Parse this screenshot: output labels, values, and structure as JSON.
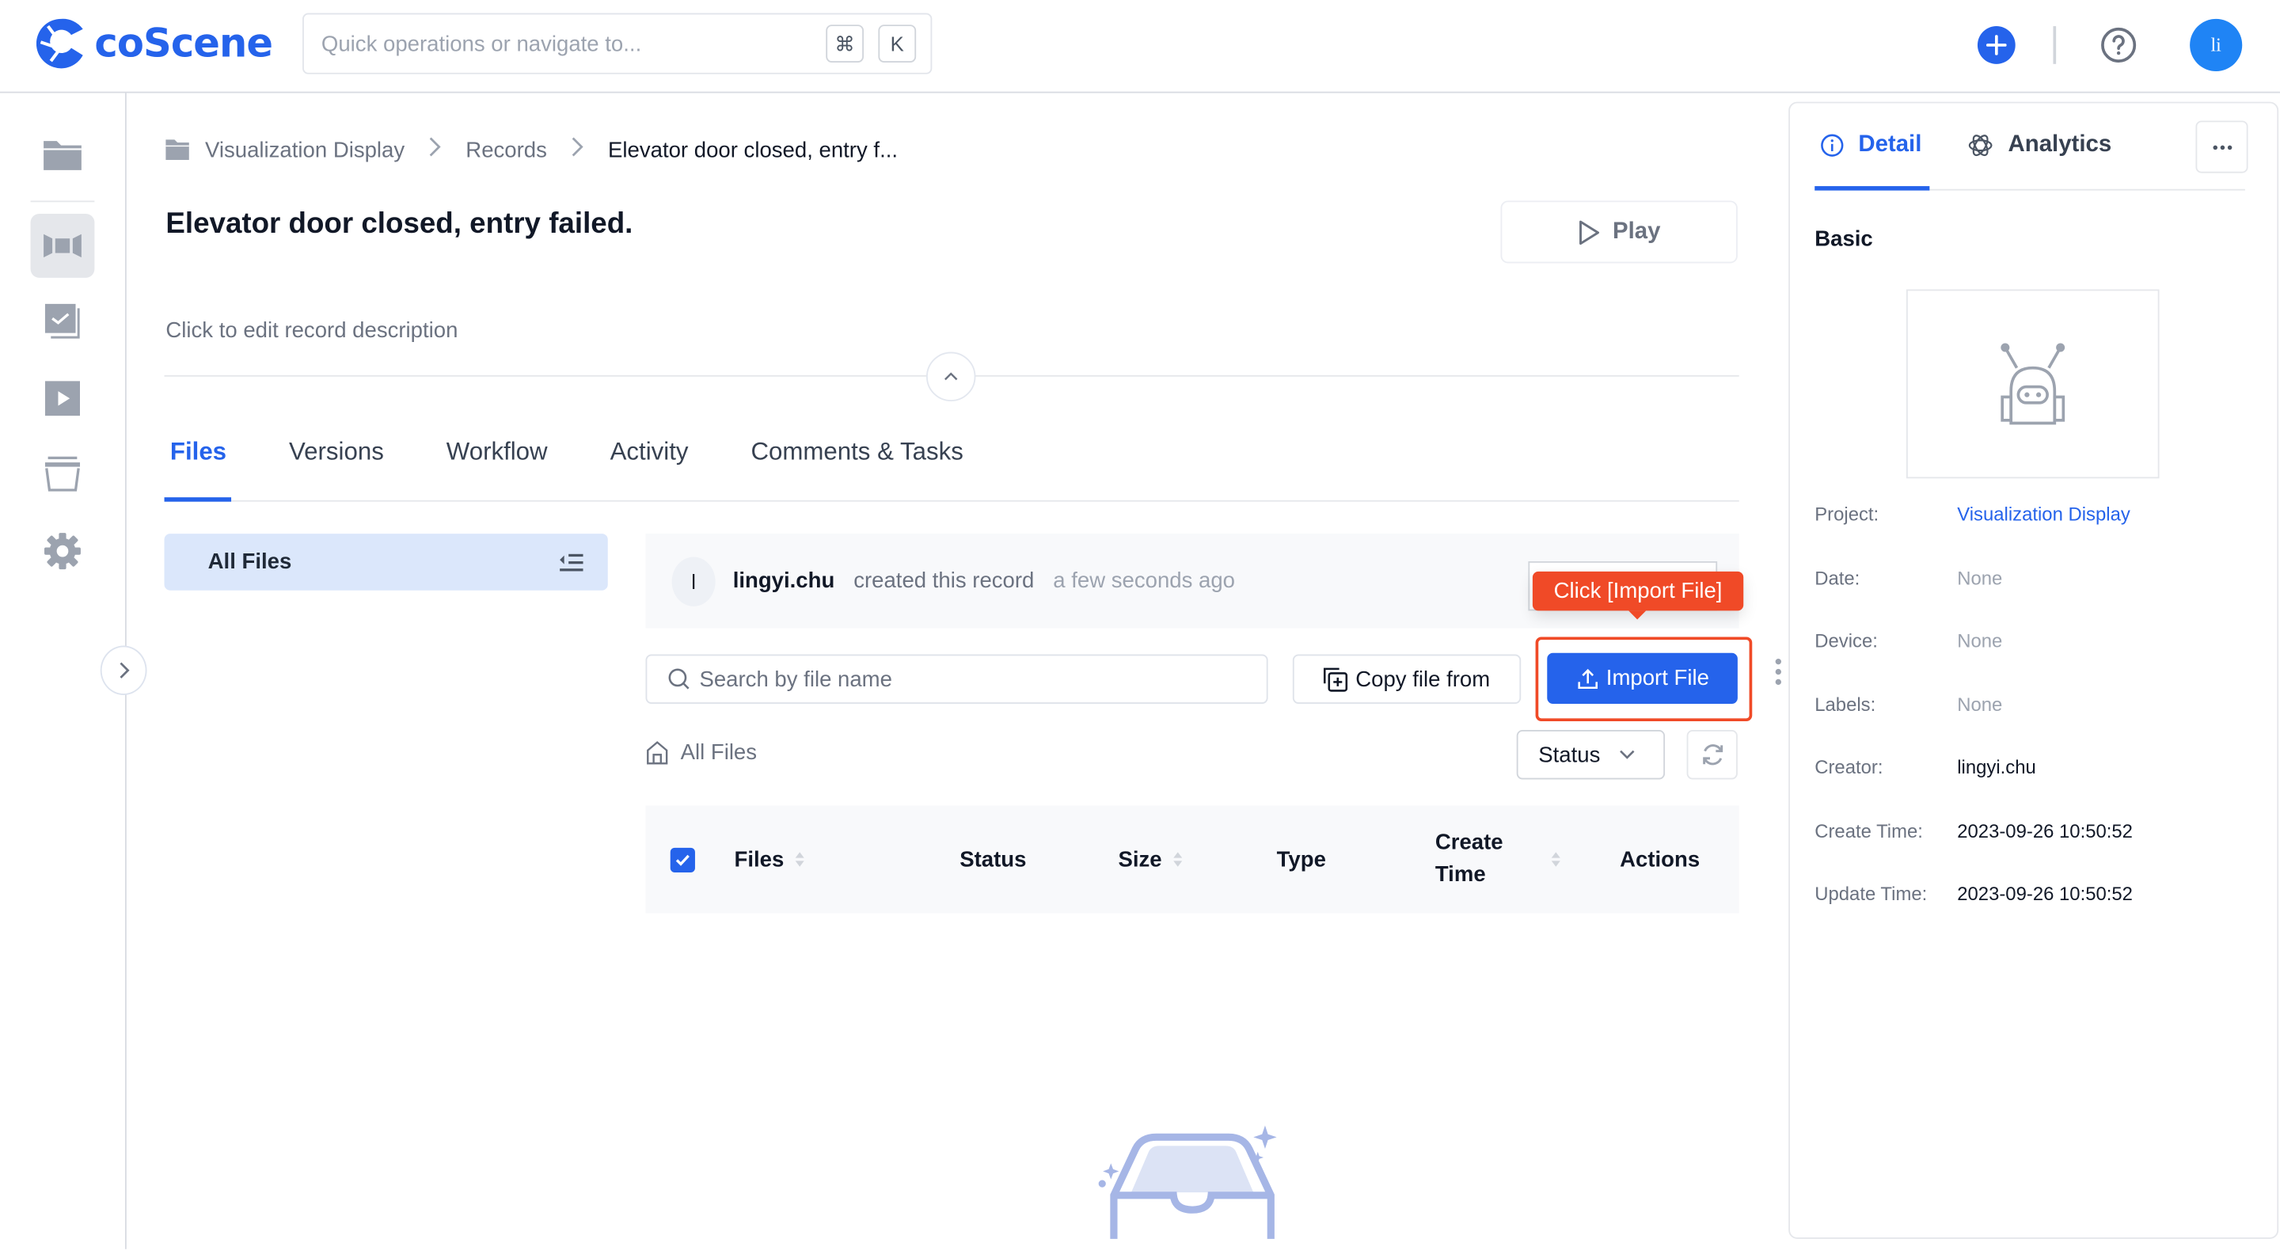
{
  "app": {
    "name": "coScene",
    "brand_color": "#2563eb",
    "search": {
      "placeholder": "Quick operations or navigate to...",
      "shortcut_keys": [
        "⌘",
        "K"
      ]
    },
    "avatar_initials": "li"
  },
  "sidebar": {
    "items": [
      {
        "name": "projects",
        "icon": "folder-icon",
        "active": false
      },
      {
        "name": "records",
        "icon": "records-icon",
        "active": true
      },
      {
        "name": "tasks",
        "icon": "task-check-icon",
        "active": false
      },
      {
        "name": "playback",
        "icon": "play-icon",
        "active": false
      },
      {
        "name": "archive",
        "icon": "archive-icon",
        "active": false
      },
      {
        "name": "settings",
        "icon": "gear-icon",
        "active": false
      }
    ]
  },
  "breadcrumb": {
    "items": [
      "Visualization Display",
      "Records",
      "Elevator door closed, entry f..."
    ]
  },
  "record": {
    "title": "Elevator door closed, entry failed.",
    "description_placeholder": "Click to edit record description",
    "play_label": "Play"
  },
  "tabs": [
    {
      "label": "Files",
      "active": true
    },
    {
      "label": "Versions",
      "active": false
    },
    {
      "label": "Workflow",
      "active": false
    },
    {
      "label": "Activity",
      "active": false
    },
    {
      "label": "Comments & Tasks",
      "active": false
    }
  ],
  "files": {
    "nav_label": "All Files",
    "activity": {
      "avatar": "l",
      "user": "lingyi.chu",
      "action": "created this record",
      "time": "a few seconds ago"
    },
    "search_placeholder": "Search by file name",
    "copy_label": "Copy file from",
    "import_label": "Import File",
    "tooltip": "Click [Import File]",
    "path_label": "All Files",
    "status_filter": "Status",
    "columns": [
      "Files",
      "Status",
      "Size",
      "Type",
      "Create Time",
      "Actions"
    ],
    "rows": []
  },
  "detail_panel": {
    "tabs": [
      {
        "label": "Detail",
        "active": true
      },
      {
        "label": "Analytics",
        "active": false
      }
    ],
    "section": "Basic",
    "properties": [
      {
        "key": "Project:",
        "value": "Visualization Display",
        "style": "link"
      },
      {
        "key": "Date:",
        "value": "None",
        "style": "none"
      },
      {
        "key": "Device:",
        "value": "None",
        "style": "none"
      },
      {
        "key": "Labels:",
        "value": "None",
        "style": "none"
      },
      {
        "key": "Creator:",
        "value": "lingyi.chu",
        "style": "normal"
      },
      {
        "key": "Create Time:",
        "value": "2023-09-26 10:50:52",
        "style": "normal"
      },
      {
        "key": "Update Time:",
        "value": "2023-09-26 10:50:52",
        "style": "normal"
      }
    ]
  },
  "colors": {
    "accent": "#2563eb",
    "highlight": "#f04a27",
    "avatar": "#1f84f5"
  }
}
